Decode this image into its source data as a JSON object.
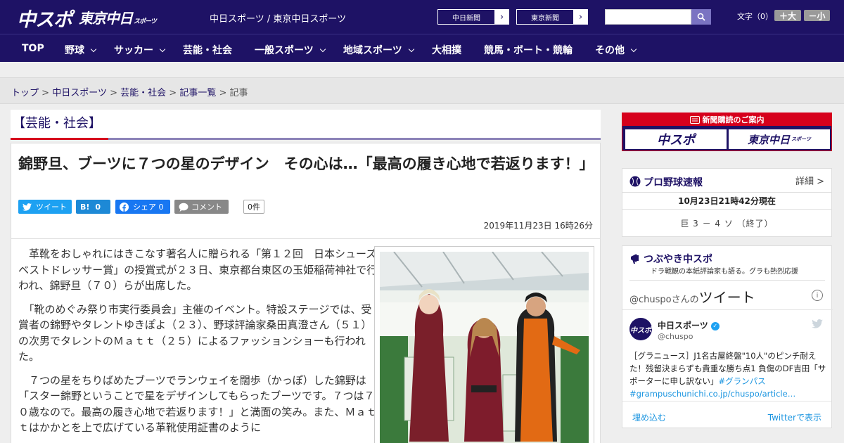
{
  "header": {
    "logo_chunichi": "中スポ",
    "logo_tokyo": "東京中日",
    "logo_tokyo_sub": "スポーツ",
    "site_title": "中日スポーツ / 東京中日スポーツ",
    "paper_links": [
      "中日新聞",
      "東京新聞"
    ],
    "search_placeholder": "",
    "font_size_label": "文字（0）",
    "font_larger": "＋大",
    "font_smaller": "－小"
  },
  "nav": {
    "items": [
      {
        "label": "TOP",
        "dropdown": false
      },
      {
        "label": "野球",
        "dropdown": true
      },
      {
        "label": "サッカー",
        "dropdown": true
      },
      {
        "label": "芸能・社会",
        "dropdown": false
      },
      {
        "label": "一般スポーツ",
        "dropdown": true
      },
      {
        "label": "地域スポーツ",
        "dropdown": true
      },
      {
        "label": "大相撲",
        "dropdown": false
      },
      {
        "label": "競馬・ボート・競輪",
        "dropdown": false
      },
      {
        "label": "その他",
        "dropdown": true
      }
    ]
  },
  "breadcrumb": {
    "items": [
      "トップ",
      "中日スポーツ",
      "芸能・社会",
      "記事一覧"
    ],
    "current": "記事",
    "separator": ">"
  },
  "article": {
    "category": "【芸能・社会】",
    "headline": "錦野旦、ブーツに７つの星のデザイン　その心は…「最高の履き心地で若返ります！」",
    "share": {
      "tweet": "ツイート",
      "hatena_label": "B!",
      "hatena_count": "0",
      "facebook": "シェア 0",
      "comment": "コメント",
      "comment_count": "0件"
    },
    "date": "2019年11月23日 16時26分",
    "paragraphs": [
      "革靴をおしゃれにはきこなす著名人に贈られる「第１２回　日本シューズベストドレッサー賞」の授賞式が２３日、東京都台東区の玉姫稲荷神社で行われ、錦野旦（７０）らが出席した。",
      "「靴のめぐみ祭り市実行委員会」主催のイベント。特設ステージでは、受賞者の錦野やタレントゆきぽよ（２３）、野球評論家桑田真澄さん（５１）の次男でタレントのＭａｔｔ（２５）によるファッションショーも行われた。",
      "７つの星をちりばめたブーツでランウェイを闊歩（かっぽ）した錦野は「スター錦野ということで星をデザインしてもらったブーツです。７つは７０歳なので。最高の履き心地で若返ります！」と満面の笑み。また、Ｍａｔｔはかかとを上で広げている革靴使用証書のように"
    ]
  },
  "sidebar": {
    "subscribe": {
      "title": "新聞購読のご案内",
      "buttons": [
        "中スポ",
        "東京中日"
      ],
      "tokyo_sub": "スポーツ"
    },
    "baseball": {
      "title": "プロ野球速報",
      "more": "詳細 >",
      "time": "10月23日21時42分現在",
      "score": "巨 3 － 4 ソ （終了）"
    },
    "twitter": {
      "title": "つぶやき中スポ",
      "subtitle": "ドラ戦観の本紙評論家も語る。グラも熱烈応援",
      "handle_head": "@chuspo",
      "san": "さんの",
      "tweets_label": "ツイート",
      "account_name": "中日スポーツ",
      "account_user": "@chuspo",
      "avatar_text": "中スポ",
      "tweet_text": "［グラニュース］J1名古屋終盤\"10人\"のピンチ耐えた！残留決まらずも貴重な勝ち点1 負傷のDF吉田「サポーターに申し訳ない」",
      "tweet_hashtag": "#グランパス",
      "tweet_link": "#grampuschunichi.co.jp/chuspo/article…",
      "embed": "埋め込む",
      "view_on": "Twitterで表示"
    }
  },
  "colors": {
    "brand_navy": "#1e1265",
    "accent_red": "#d6001c",
    "twitter_blue": "#1da1f2",
    "facebook_blue": "#1877f2",
    "hatena_blue": "#1d89d6"
  }
}
